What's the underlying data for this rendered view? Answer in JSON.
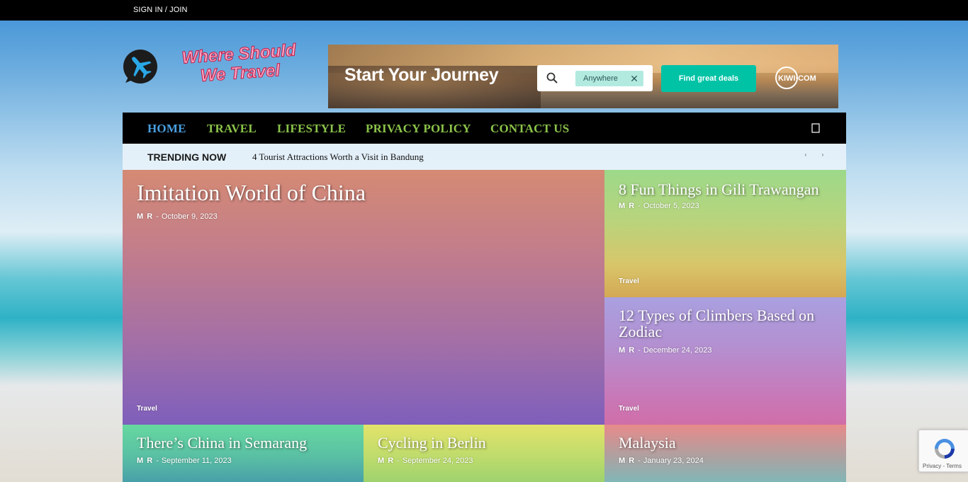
{
  "topbar": {
    "signin_label": "SIGN IN / JOIN"
  },
  "logo": {
    "line1": "Where Should",
    "line2": "We Travel"
  },
  "banner": {
    "heading": "Start Your Journey",
    "search_chip": "Anywhere",
    "cta": "Find great deals",
    "brand": "KIWI·COM",
    "accent_color": "#00c3a6"
  },
  "nav": {
    "items": [
      {
        "label": "HOME",
        "active": true
      },
      {
        "label": "TRAVEL"
      },
      {
        "label": "LIFESTYLE"
      },
      {
        "label": "PRIVACY POLICY"
      },
      {
        "label": "CONTACT US"
      }
    ],
    "search_icon": "\u0000",
    "link_color": "#8bc34a",
    "active_color": "#4a9fe0"
  },
  "trending": {
    "label": "TRENDING NOW",
    "text": "4 Tourist Attractions Worth a Visit in Bandung",
    "prev_glyph": "‹",
    "next_glyph": "›"
  },
  "tiles": [
    {
      "title": "Imitation World of China",
      "author": "M R",
      "date": "October 9, 2023",
      "category": "Travel"
    },
    {
      "title": "8 Fun Things in Gili Trawangan",
      "author": "M R",
      "date": "October 5, 2023",
      "category": "Travel"
    },
    {
      "title": "12 Types of Climbers Based on Zodiac",
      "author": "M R",
      "date": "December 24, 2023",
      "category": "Travel"
    },
    {
      "title": "There’s China in Semarang",
      "author": "M R",
      "date": "September 11, 2023"
    },
    {
      "title": "Cycling in Berlin",
      "author": "M R",
      "date": "September 24, 2023"
    },
    {
      "title": "Malaysia",
      "author": "M R",
      "date": "January 23, 2024"
    }
  ],
  "meta_separator": "-",
  "recaptcha": {
    "links": "Privacy - Terms"
  }
}
